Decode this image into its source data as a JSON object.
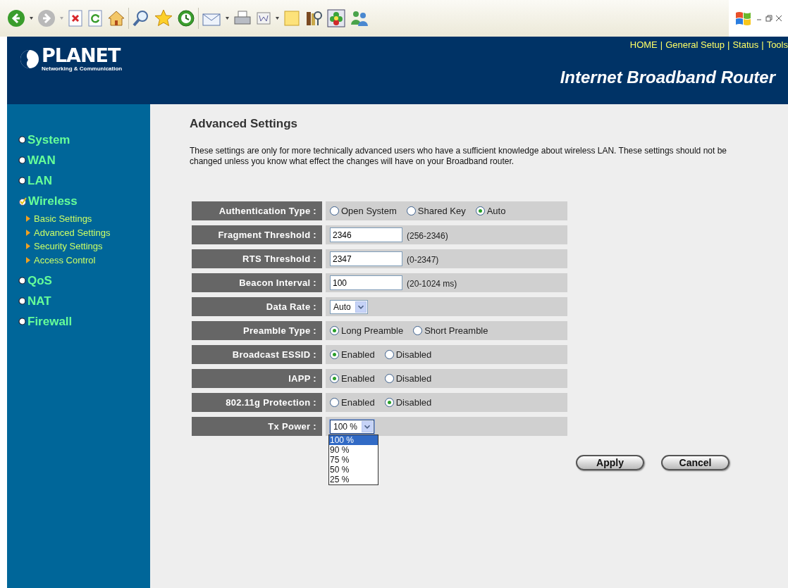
{
  "header": {
    "logo": "PLANET",
    "logo_tagline": "Networking & Communication",
    "links": [
      "HOME",
      "General Setup",
      "Status",
      "Tools"
    ],
    "link_separator": "|",
    "product": "Internet Broadband Router"
  },
  "sidebar": {
    "items": [
      {
        "label": "System",
        "selected": false
      },
      {
        "label": "WAN",
        "selected": false
      },
      {
        "label": "LAN",
        "selected": false
      },
      {
        "label": "Wireless",
        "selected": true,
        "children": [
          {
            "label": "Basic Settings"
          },
          {
            "label": "Advanced Settings"
          },
          {
            "label": "Security Settings"
          },
          {
            "label": "Access Control"
          }
        ]
      },
      {
        "label": "QoS",
        "selected": false
      },
      {
        "label": "NAT",
        "selected": false
      },
      {
        "label": "Firewall",
        "selected": false
      }
    ]
  },
  "page": {
    "title": "Advanced Settings",
    "description": "These settings are only for more technically advanced users who have a sufficient knowledge about wireless LAN. These settings should not be changed unless you know what effect the changes will have on your Broadband router."
  },
  "form": {
    "rows": [
      {
        "label": "Authentication Type :",
        "kind": "radio",
        "options": [
          {
            "label": "Open System",
            "selected": false
          },
          {
            "label": "Shared Key",
            "selected": false
          },
          {
            "label": "Auto",
            "selected": true
          }
        ]
      },
      {
        "label": "Fragment Threshold :",
        "kind": "text",
        "value": "2346",
        "hint": "(256-2346)"
      },
      {
        "label": "RTS Threshold :",
        "kind": "text",
        "value": "2347",
        "hint": "(0-2347)"
      },
      {
        "label": "Beacon Interval :",
        "kind": "text",
        "value": "100",
        "hint": "(20-1024 ms)"
      },
      {
        "label": "Data Rate :",
        "kind": "select",
        "value": "Auto",
        "expanded": false
      },
      {
        "label": "Preamble Type :",
        "kind": "radio",
        "options": [
          {
            "label": "Long Preamble",
            "selected": true
          },
          {
            "label": "Short Preamble",
            "selected": false
          }
        ]
      },
      {
        "label": "Broadcast ESSID :",
        "kind": "radio",
        "options": [
          {
            "label": "Enabled",
            "selected": true
          },
          {
            "label": "Disabled",
            "selected": false
          }
        ]
      },
      {
        "label": "IAPP :",
        "kind": "radio",
        "options": [
          {
            "label": "Enabled",
            "selected": true
          },
          {
            "label": "Disabled",
            "selected": false
          }
        ]
      },
      {
        "label": "802.11g Protection :",
        "kind": "radio",
        "options": [
          {
            "label": "Enabled",
            "selected": false
          },
          {
            "label": "Disabled",
            "selected": true
          }
        ]
      },
      {
        "label": "Tx Power :",
        "kind": "select",
        "value": "100 %",
        "expanded": true,
        "options": [
          {
            "label": "100 %",
            "selected": true
          },
          {
            "label": "90 %",
            "selected": false
          },
          {
            "label": "75 %",
            "selected": false
          },
          {
            "label": "50 %",
            "selected": false
          },
          {
            "label": "25 %",
            "selected": false
          }
        ]
      }
    ]
  },
  "buttons": [
    "Apply",
    "Cancel"
  ]
}
